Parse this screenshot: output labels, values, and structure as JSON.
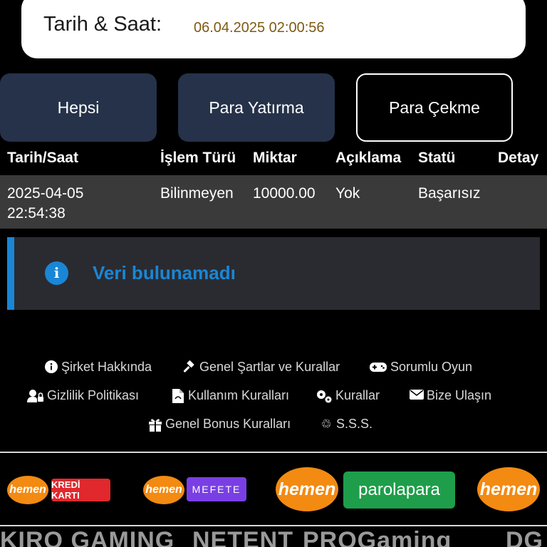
{
  "datetime": {
    "label": "Tarih & Saat:",
    "value": "06.04.2025 02:00:56"
  },
  "tabs": [
    {
      "label": "Hepsi",
      "active": false
    },
    {
      "label": "Para Yatırma",
      "active": false
    },
    {
      "label": "Para Çekme",
      "active": true
    }
  ],
  "table": {
    "headers": [
      "Tarih/Saat",
      "İşlem Türü",
      "Miktar",
      "Açıklama",
      "Statü",
      "Detay"
    ],
    "rows": [
      {
        "date": "2025-04-05",
        "time": "22:54:38",
        "type": "Bilinmeyen",
        "amount": "10000.00",
        "description": "Yok",
        "status": "Başarısız",
        "detail": ""
      }
    ]
  },
  "alert": {
    "icon": "info-icon",
    "message": "Veri bulunamadı",
    "color": "#1a86d6"
  },
  "footer_links": [
    {
      "label": "Şirket Hakkında",
      "icon": "info-circle-icon"
    },
    {
      "label": "Genel Şartlar ve Kurallar",
      "icon": "gavel-icon"
    },
    {
      "label": "Sorumlu Oyun",
      "icon": "gamepad-icon"
    },
    {
      "label": "Gizlilik Politikası",
      "icon": "user-lock-icon"
    },
    {
      "label": "Kullanım Kuralları",
      "icon": "file-pdf-icon"
    },
    {
      "label": "Kurallar",
      "icon": "cogs-icon"
    },
    {
      "label": "Bize Ulaşın",
      "icon": "envelope-icon"
    },
    {
      "label": "Genel Bonus Kuralları",
      "icon": "gift-icon"
    },
    {
      "label": "S.S.S.",
      "icon": "recycle-icon"
    }
  ],
  "payments": [
    {
      "hemen": "hemen",
      "brand": "KREDİ KARTI",
      "brand_color": "#e0282d"
    },
    {
      "hemen": "hemen",
      "brand": "MEFETE",
      "brand_color": "#7a3fe4"
    },
    {
      "hemen": "hemen",
      "brand": "parolapara",
      "brand_color": "#1e9e4a"
    },
    {
      "hemen": "hemen",
      "brand": "",
      "brand_color": ""
    }
  ],
  "providers": [
    "KIRO GAMING",
    "NETENT",
    "PROGaming",
    "DG"
  ],
  "colors": {
    "tab_bg": "#25324a",
    "accent_gold": "#7d5a12",
    "row_bg": "#3a3a3a"
  }
}
